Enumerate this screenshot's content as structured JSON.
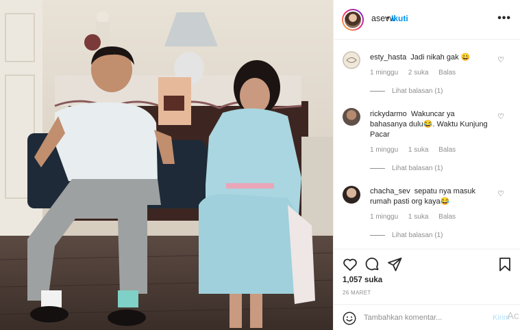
{
  "post": {
    "username": "asevw",
    "separator": "•",
    "follow_label": "Ikuti",
    "more_label": "•••",
    "likes": "1,057 suka",
    "date": "26 MARET"
  },
  "comments": [
    {
      "user": "esty_hasta",
      "text": "Jadi nikah gak 😀",
      "time": "1 minggu",
      "likes": "2 suka",
      "reply": "Balas",
      "view_replies": "Lihat balasan (1)"
    },
    {
      "user": "rickydarmo",
      "text": "Wakuncar ya bahasanya dulu😂. Waktu Kunjung Pacar",
      "time": "1 minggu",
      "likes": "1 suka",
      "reply": "Balas",
      "view_replies": "Lihat balasan (1)"
    },
    {
      "user": "chacha_sev",
      "text": "sepatu nya masuk rumah pasti org kaya😂",
      "time": "1 minggu",
      "likes": "1 suka",
      "reply": "Balas",
      "view_replies": "Lihat balasan (1)"
    }
  ],
  "composer": {
    "placeholder": "Tambahkan komentar...",
    "post_label": "Kirim",
    "overflow_text": "Ac"
  },
  "icons": {
    "heart": "heart-icon",
    "comment": "comment-icon",
    "share": "share-icon",
    "bookmark": "bookmark-icon",
    "emoji": "emoji-icon",
    "more": "more-icon"
  },
  "colors": {
    "accent": "#0095f6",
    "text": "#262626",
    "muted": "#8e8e8e",
    "border": "#efefef"
  }
}
